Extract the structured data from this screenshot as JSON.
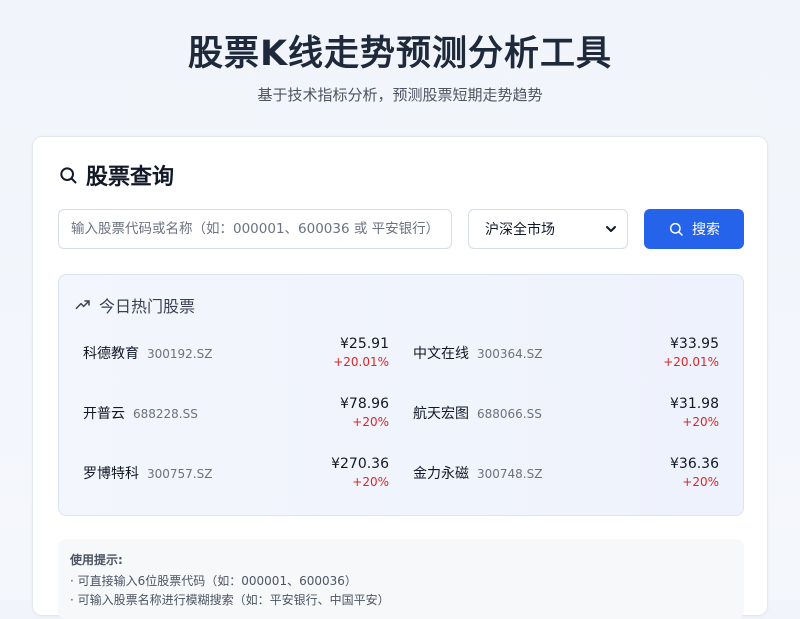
{
  "header": {
    "title": "股票K线走势预测分析工具",
    "subtitle": "基于技术指标分析，预测股票短期走势趋势"
  },
  "search_card": {
    "title": "股票查询",
    "input_placeholder": "输入股票代码或名称（如：000001、600036 或 平安银行）",
    "input_value": "",
    "market_select": "沪深全市场",
    "search_button": "搜索"
  },
  "hot": {
    "title": "今日热门股票",
    "stocks": [
      {
        "name": "科德教育",
        "code": "300192.SZ",
        "price": "¥25.91",
        "change": "+20.01%"
      },
      {
        "name": "中文在线",
        "code": "300364.SZ",
        "price": "¥33.95",
        "change": "+20.01%"
      },
      {
        "name": "开普云",
        "code": "688228.SS",
        "price": "¥78.96",
        "change": "+20%"
      },
      {
        "name": "航天宏图",
        "code": "688066.SS",
        "price": "¥31.98",
        "change": "+20%"
      },
      {
        "name": "罗博特科",
        "code": "300757.SZ",
        "price": "¥270.36",
        "change": "+20%"
      },
      {
        "name": "金力永磁",
        "code": "300748.SZ",
        "price": "¥36.36",
        "change": "+20%"
      }
    ]
  },
  "tips": {
    "title": "使用提示:",
    "items": [
      "· 可直接输入6位股票代码（如：000001、600036）",
      "· 可输入股票名称进行模糊搜索（如：平安银行、中国平安）"
    ]
  },
  "colors": {
    "primary": "#2563eb",
    "rise": "#dc2626"
  }
}
